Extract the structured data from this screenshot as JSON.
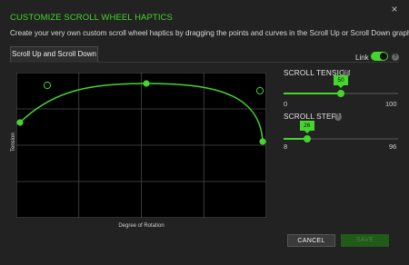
{
  "dialog": {
    "title": "CUSTOMIZE SCROLL WHEEL HAPTICS",
    "description": "Create your very own custom scroll wheel haptics by dragging the points and curves in the Scroll Up or Scroll Down graphs.",
    "close_icon": "×"
  },
  "tabs": [
    {
      "label": "Scroll Up and Scroll Down",
      "active": true
    }
  ],
  "graph": {
    "y_label": "Tension",
    "x_label": "Degree of Rotation"
  },
  "link": {
    "label": "Link",
    "enabled": true,
    "help": "?"
  },
  "scroll_tension": {
    "label": "SCROLL TENSION",
    "value": "50",
    "min": "0",
    "max": "100",
    "fraction": 0.5,
    "help": "?"
  },
  "scroll_steps": {
    "label": "SCROLL STEPS",
    "value": "26",
    "min": "8",
    "max": "96",
    "fraction": 0.2045,
    "help": "?"
  },
  "buttons": {
    "cancel": "CANCEL",
    "save": "SAVE"
  },
  "colors": {
    "accent": "#44d62c",
    "background": "#222222",
    "graph_bg": "#000000"
  }
}
